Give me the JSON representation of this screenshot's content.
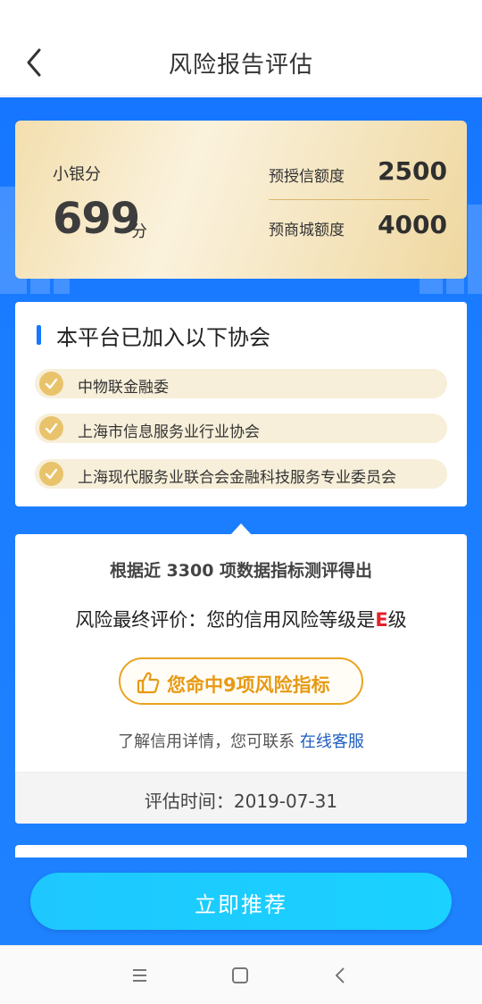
{
  "header": {
    "title": "风险报告评估",
    "back_icon": "chevron-left-icon"
  },
  "score_card": {
    "label": "小银分",
    "value": "699",
    "unit": "分",
    "quotas": [
      {
        "label": "预授信额度",
        "value": "2500"
      },
      {
        "label": "预商城额度",
        "value": "4000"
      }
    ]
  },
  "associations": {
    "title": "本平台已加入以下协会",
    "items": [
      {
        "label": "中物联金融委"
      },
      {
        "label": "上海市信息服务业行业协会"
      },
      {
        "label": "上海现代服务业联合会金融科技服务专业委员会"
      }
    ]
  },
  "result": {
    "basis_text": "根据近 3300 项数据指标测评得出",
    "rating_prefix": "风险最终评价：您的信用风险等级是",
    "grade": "E",
    "rating_suffix": "级",
    "hit_button_label": "您命中9项风险指标",
    "contact_text": "了解信用详情，您可联系 ",
    "contact_link": "在线客服",
    "eval_time": "评估时间：2019-07-31"
  },
  "actions": {
    "recommend_label": "立即推荐"
  },
  "colors": {
    "brand_blue": "#1677ff",
    "grade_red": "#e4202a",
    "hit_orange": "#e79a15",
    "gold": "#e9c36b",
    "button_cyan": "#1ec8ff"
  },
  "system_nav": {
    "icons": [
      "menu-icon",
      "home-square-icon",
      "back-triangle-icon"
    ]
  }
}
